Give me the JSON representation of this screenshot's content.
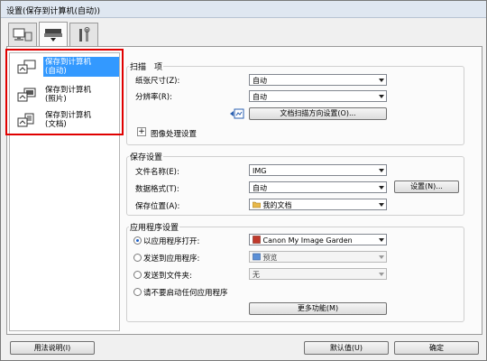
{
  "window": {
    "title": "设置(保存到计算机(自动))"
  },
  "tabs": [
    {
      "name": "scan-from-computer",
      "icon": "monitor-icon"
    },
    {
      "name": "scan-from-operation-panel",
      "icon": "scanner-icon"
    },
    {
      "name": "general-settings",
      "icon": "tools-icon"
    }
  ],
  "modes": [
    {
      "label": "保存到计算机\n(自动)",
      "selected": true
    },
    {
      "label": "保存到计算机\n(照片)",
      "selected": false
    },
    {
      "label": "保存到计算机\n(文档)",
      "selected": false
    }
  ],
  "scan_options": {
    "title": "扫描　项",
    "paper_size_label": "纸张尺寸(Z):",
    "paper_size_value": "自动",
    "resolution_label": "分辨率(R):",
    "resolution_value": "自动",
    "orientation_button": "文档扫描方向设置(O)...",
    "image_processing_label": "图像处理设置"
  },
  "save_settings": {
    "title": "保存设置",
    "filename_label": "文件名称(E):",
    "filename_value": "IMG",
    "format_label": "数据格式(T):",
    "format_value": "自动",
    "format_settings_button": "设置(N)...",
    "location_label": "保存位置(A):",
    "location_value": "我的文档"
  },
  "app_settings": {
    "title": "应用程序设置",
    "open_app_label": "以应用程序打开:",
    "open_app_value": "Canon My Image Garden",
    "send_app_label": "发送到应用程序:",
    "send_app_value": "预览",
    "send_folder_label": "发送到文件夹:",
    "send_folder_value": "无",
    "no_app_label": "请不要启动任何应用程序",
    "more_button": "更多功能(M)"
  },
  "footer": {
    "help_button": "用法说明(I)",
    "defaults_button": "默认值(U)",
    "ok_button": "确定"
  },
  "colors": {
    "selected": "#3399ff",
    "highlight_box": "#e00000"
  }
}
